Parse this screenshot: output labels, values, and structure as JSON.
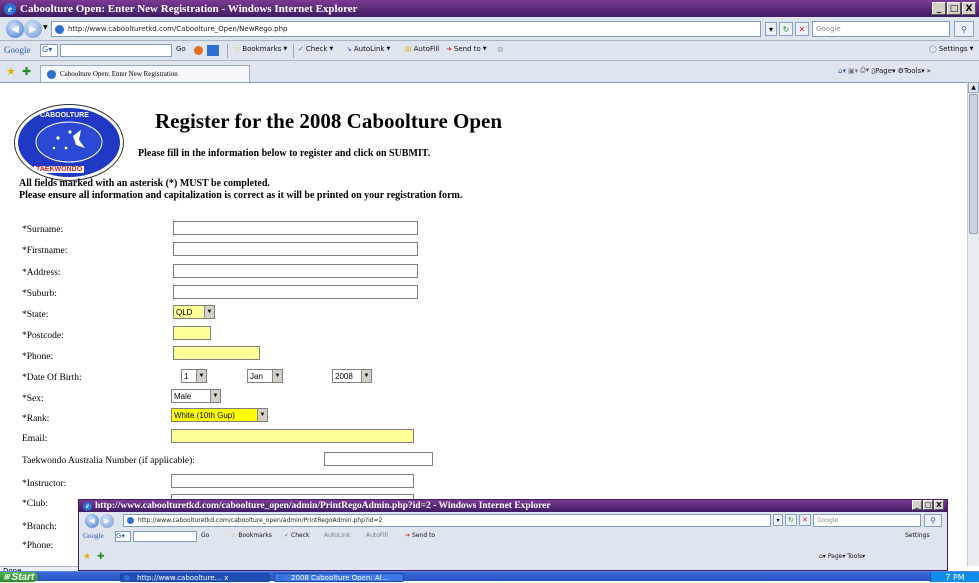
{
  "window": {
    "title": "Caboolture Open: Enter New Registration - Windows Internet Explorer",
    "url": "http://www.caboolturetkd.com/Caboolture_Open/NewRego.php",
    "search_placeholder": "Google",
    "minimize": "_",
    "maximize": "□",
    "close": "X"
  },
  "toolbar": {
    "google_label": "Google",
    "go_label": "Go",
    "bookmarks": "Bookmarks",
    "check": "Check",
    "autolink": "AutoLink",
    "autofill": "AutoFill",
    "sendto": "Send to",
    "settings": "Settings"
  },
  "tabs": {
    "active": "Caboolture Open: Enter New Registration"
  },
  "command_bar": {
    "page": "Page",
    "tools": "Tools"
  },
  "page": {
    "logo_text_top": "CABOOLTURE",
    "logo_text_bottom": "TAEKWONDO",
    "heading": "Register for the 2008 Caboolture Open",
    "subheading": "Please fill in the information below to register and click on SUBMIT.",
    "note1": "All fields marked with an asterisk (*) MUST be completed.",
    "note2": "Please ensure all information and capitalization is correct as it will be printed on your registration form."
  },
  "form": {
    "surname": "*Surname:",
    "firstname": "*Firstname:",
    "address": "*Address:",
    "suburb": "*Suburb:",
    "state": "*State:",
    "state_value": "QLD",
    "postcode": "*Postcode:",
    "phone": "*Phone:",
    "dob": "*Date Of Birth:",
    "dob_day": "1",
    "dob_month": "Jan",
    "dob_year": "2008",
    "sex": "*Sex:",
    "sex_value": "Male",
    "rank": "*Rank:",
    "rank_value": "White (10th Gup)",
    "email": "Email:",
    "ta_number": "Taekwondo Australia Number (if applicable):",
    "instructor": "*Instructor:",
    "club": "*Club:",
    "branch": "*Branch:",
    "phone2": "*Phone:"
  },
  "status": {
    "text": "Done"
  },
  "second_window": {
    "title": "http://www.caboolturetkd.com/caboolture_open/admin/PrintRegoAdmin.php?id=2 - Windows Internet Explorer",
    "url": "http://www.caboolturetkd.com/caboolture_open/admin/PrintRegoAdmin.php?id=2",
    "search_placeholder": "Google",
    "google_label": "Google",
    "go_label": "Go",
    "bookmarks": "Bookmarks",
    "check": "Check",
    "autolink": "AutoLink",
    "autofill": "AutoFill",
    "sendto": "Send to",
    "settings": "Settings",
    "page": "Page",
    "tools": "Tools"
  },
  "taskbar": {
    "start": "Start",
    "item1": "http://www.caboolture...",
    "item1_close": "x",
    "item2": "2008 Caboolture Open: Al...",
    "clock": "7 PM"
  },
  "colors": {
    "title_gradient_top": "#7b3a93",
    "title_gradient_bottom": "#3f1c63",
    "required_field_yellow": "#ffff99",
    "rank_select_yellow": "#ffff00",
    "taskbar_blue": "#2452c2"
  }
}
